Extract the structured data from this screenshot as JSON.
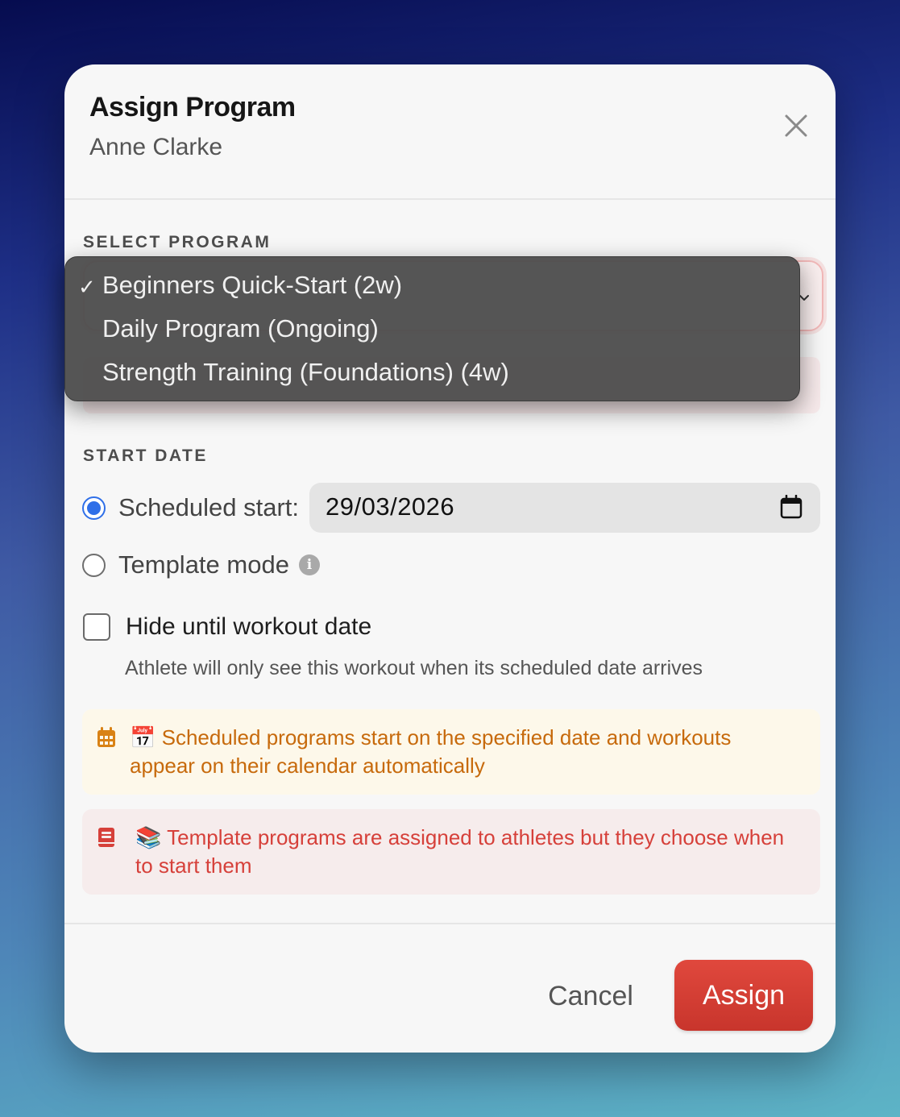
{
  "modal": {
    "title": "Assign Program",
    "subtitle": "Anne Clarke"
  },
  "select_program": {
    "label": "SELECT PROGRAM",
    "selected": "Beginners Quick-Start (2w)",
    "options": [
      "Beginners Quick-Start (2w)",
      "Daily Program (Ongoing)",
      "Strength Training (Foundations) (4w)"
    ],
    "check_mark": "✓"
  },
  "start_date": {
    "label": "START DATE",
    "scheduled_label": "Scheduled start:",
    "scheduled_checked": true,
    "date_value": "29/03/2026",
    "template_label": "Template mode",
    "template_checked": false,
    "info_glyph": "i"
  },
  "hide_option": {
    "label": "Hide until workout date",
    "checked": false,
    "help": "Athlete will only see this workout when its scheduled date arrives"
  },
  "notices": {
    "scheduled": "📅 Scheduled programs start on the specified date and workouts appear on their calendar automatically",
    "template": "📚 Template programs are assigned to athletes but they choose when to start them"
  },
  "actions": {
    "cancel": "Cancel",
    "assign": "Assign"
  },
  "colors": {
    "accent": "#2f6fe8",
    "primary_button": "#d43f35",
    "notice_yellow_text": "#c76a0c",
    "notice_red_text": "#d6403a"
  },
  "icons": {
    "close": "close-icon",
    "chevron": "chevron-down-icon",
    "calendar": "calendar-icon",
    "info": "info-icon",
    "scheduled_notice": "calendar-grid-icon",
    "template_notice": "book-icon"
  }
}
